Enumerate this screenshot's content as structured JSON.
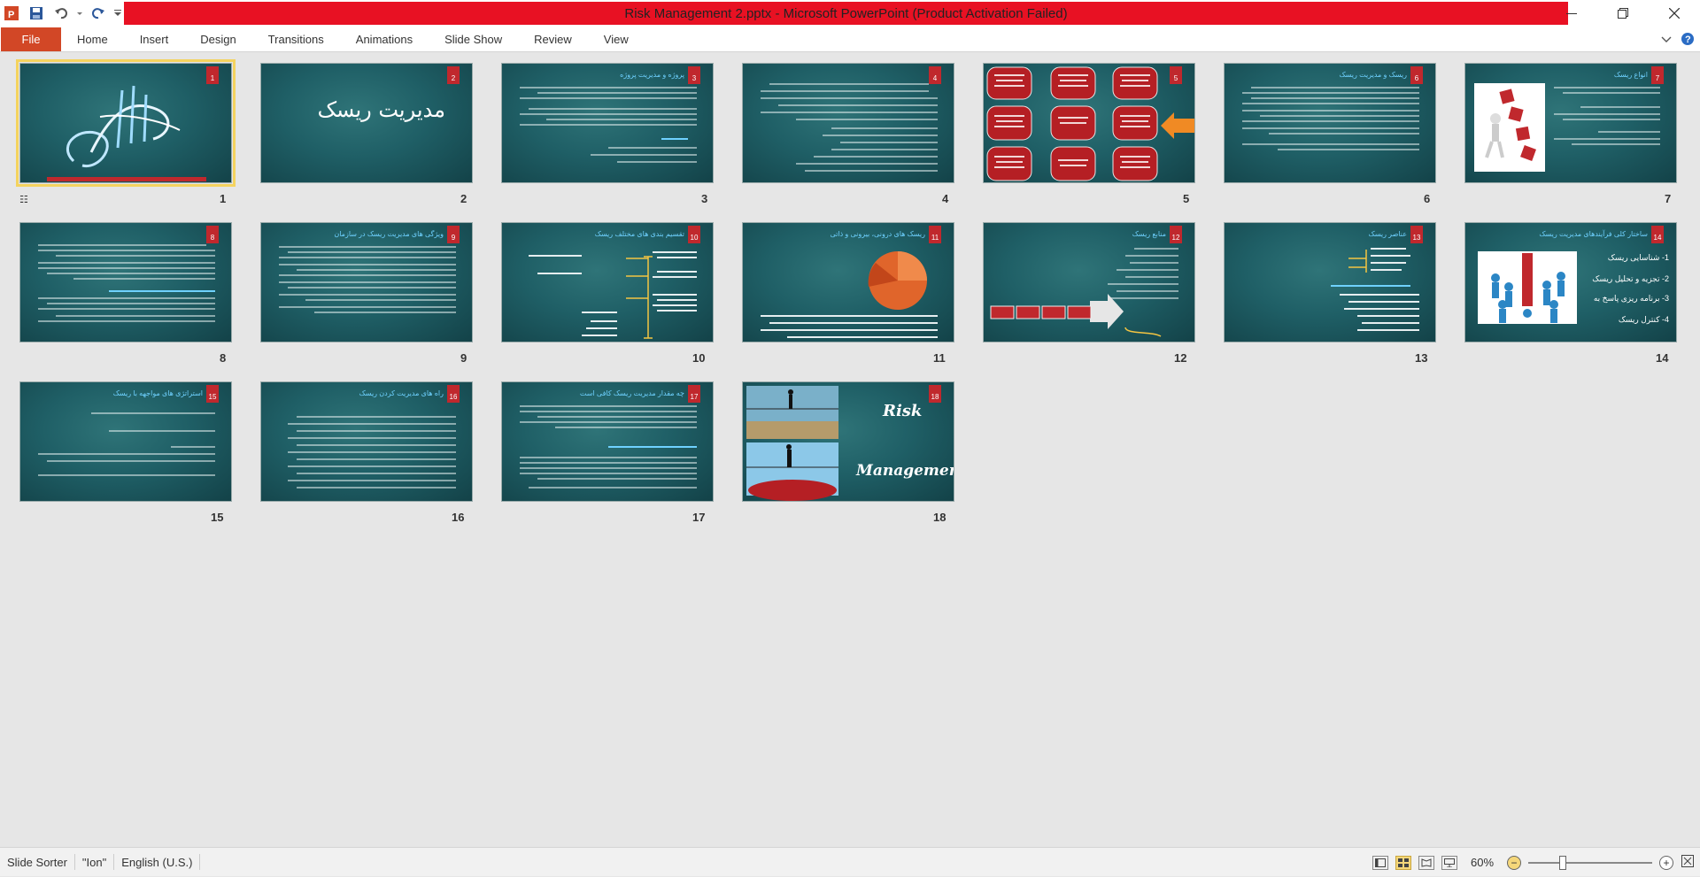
{
  "window": {
    "title": "Risk Management 2.pptx -  Microsoft PowerPoint (Product Activation Failed)"
  },
  "ribbon": {
    "file_label": "File",
    "tabs": [
      "Home",
      "Insert",
      "Design",
      "Transitions",
      "Animations",
      "Slide Show",
      "Review",
      "View"
    ]
  },
  "slides": [
    {
      "n": "1",
      "title": ""
    },
    {
      "n": "2",
      "title": "مدیریت ریسک"
    },
    {
      "n": "3",
      "title": "پروژه و مدیریت پروژه"
    },
    {
      "n": "4",
      "title": ""
    },
    {
      "n": "5",
      "title": ""
    },
    {
      "n": "6",
      "title": "ریسک و مدیریت ریسک"
    },
    {
      "n": "7",
      "title": "انواع ریسک"
    },
    {
      "n": "8",
      "title": ""
    },
    {
      "n": "9",
      "title": "ویژگی های مدیریت ریسک در سازمان"
    },
    {
      "n": "10",
      "title": "تقسیم بندی های مختلف ریسک"
    },
    {
      "n": "11",
      "title": "ریسک های درونی، بیرونی و ذاتی"
    },
    {
      "n": "12",
      "title": "منابع ریسک"
    },
    {
      "n": "13",
      "title": "عناصر ریسک"
    },
    {
      "n": "14",
      "title": "ساختار کلی فرآیندهای مدیریت ریسک"
    },
    {
      "n": "15",
      "title": "استراتژی های مواجهه با ریسک"
    },
    {
      "n": "16",
      "title": "راه های مدیریت کردن ریسک"
    },
    {
      "n": "17",
      "title": "چه مقدار مدیریت ریسک کافی است"
    },
    {
      "n": "18",
      "title": ""
    }
  ],
  "slide14_items": [
    "1- شناسایی ریسک",
    "2- تجزیه و تحلیل ریسک",
    "3- برنامه ریزی پاسخ به",
    "4- کنترل ریسک"
  ],
  "slide18": {
    "line1": "Risk",
    "line2": "Management"
  },
  "status": {
    "view": "Slide Sorter",
    "theme": "\"Ion\"",
    "language": "English (U.S.)",
    "zoom": "60%",
    "zoom_fraction": 0.28
  },
  "colors": {
    "title_bar": "#e81123",
    "file_tab": "#d24726",
    "slide_bg": "#1f5f66",
    "badge": "#c0282d"
  }
}
